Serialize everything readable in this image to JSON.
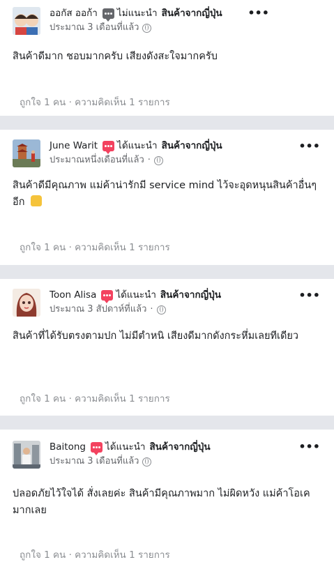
{
  "reviews": [
    {
      "name": "ออกัส ออก้า",
      "recommend": "ไม่แนะนำ",
      "page": "สินค้าจากญี่ปุ่น",
      "time": "ประมาณ 3 เดือนที่แล้ว",
      "text": "สินค้าดีมาก ชอบมากครับ เสียงดังสะใจมากครับ",
      "footer": "ถูกใจ 1 คน · ความคิดเห็น 1 รายการ",
      "rec_color": "#65676b"
    },
    {
      "name": "June Warit",
      "recommend": "ได้แนะนำ",
      "page": "สินค้าจากญี่ปุ่น",
      "time": "ประมาณหนึ่งเดือนที่แล้ว",
      "text": "สินค้าดีมีคุณภาพ แม่ค้าน่ารักมี service mind ไว้จะอุดหนุนสินค้าอื่นๆ อีก",
      "footer": "ถูกใจ 1 คน · ความคิดเห็น 1 รายการ",
      "rec_color": "#f3425f"
    },
    {
      "name": "Toon Alisa",
      "recommend": "ได้แนะนำ",
      "page": "สินค้าจากญี่ปุ่น",
      "time": "ประมาณ 3 สัปดาห์ที่แล้ว",
      "text": "สินค้าที่ได้รับตรงตามปก ไม่มีตำหนิ เสียงดีมากดังกระหึ่มเลยทีเดียว",
      "footer": "ถูกใจ 1 คน · ความคิดเห็น 1 รายการ",
      "rec_color": "#f3425f"
    },
    {
      "name": "Baitong",
      "recommend": "ได้แนะนำ",
      "page": "สินค้าจากญี่ปุ่น",
      "time": "ประมาณ 3 เดือนที่แล้ว",
      "text": "ปลอดภัยไว้ใจได้ สั่งเลยค่ะ สินค้ามีคุณภาพมาก ไม่ผิดหวัง แม่ค้าโอเคมากเลย",
      "footer": "ถูกใจ 1 คน · ความคิดเห็น 1 รายการ",
      "rec_color": "#f3425f"
    }
  ],
  "icons": {
    "more": "more-options-icon",
    "audience": "globe-icon",
    "recommend": "recommend-icon",
    "like_emoji": "thumbs-up-emoji"
  }
}
